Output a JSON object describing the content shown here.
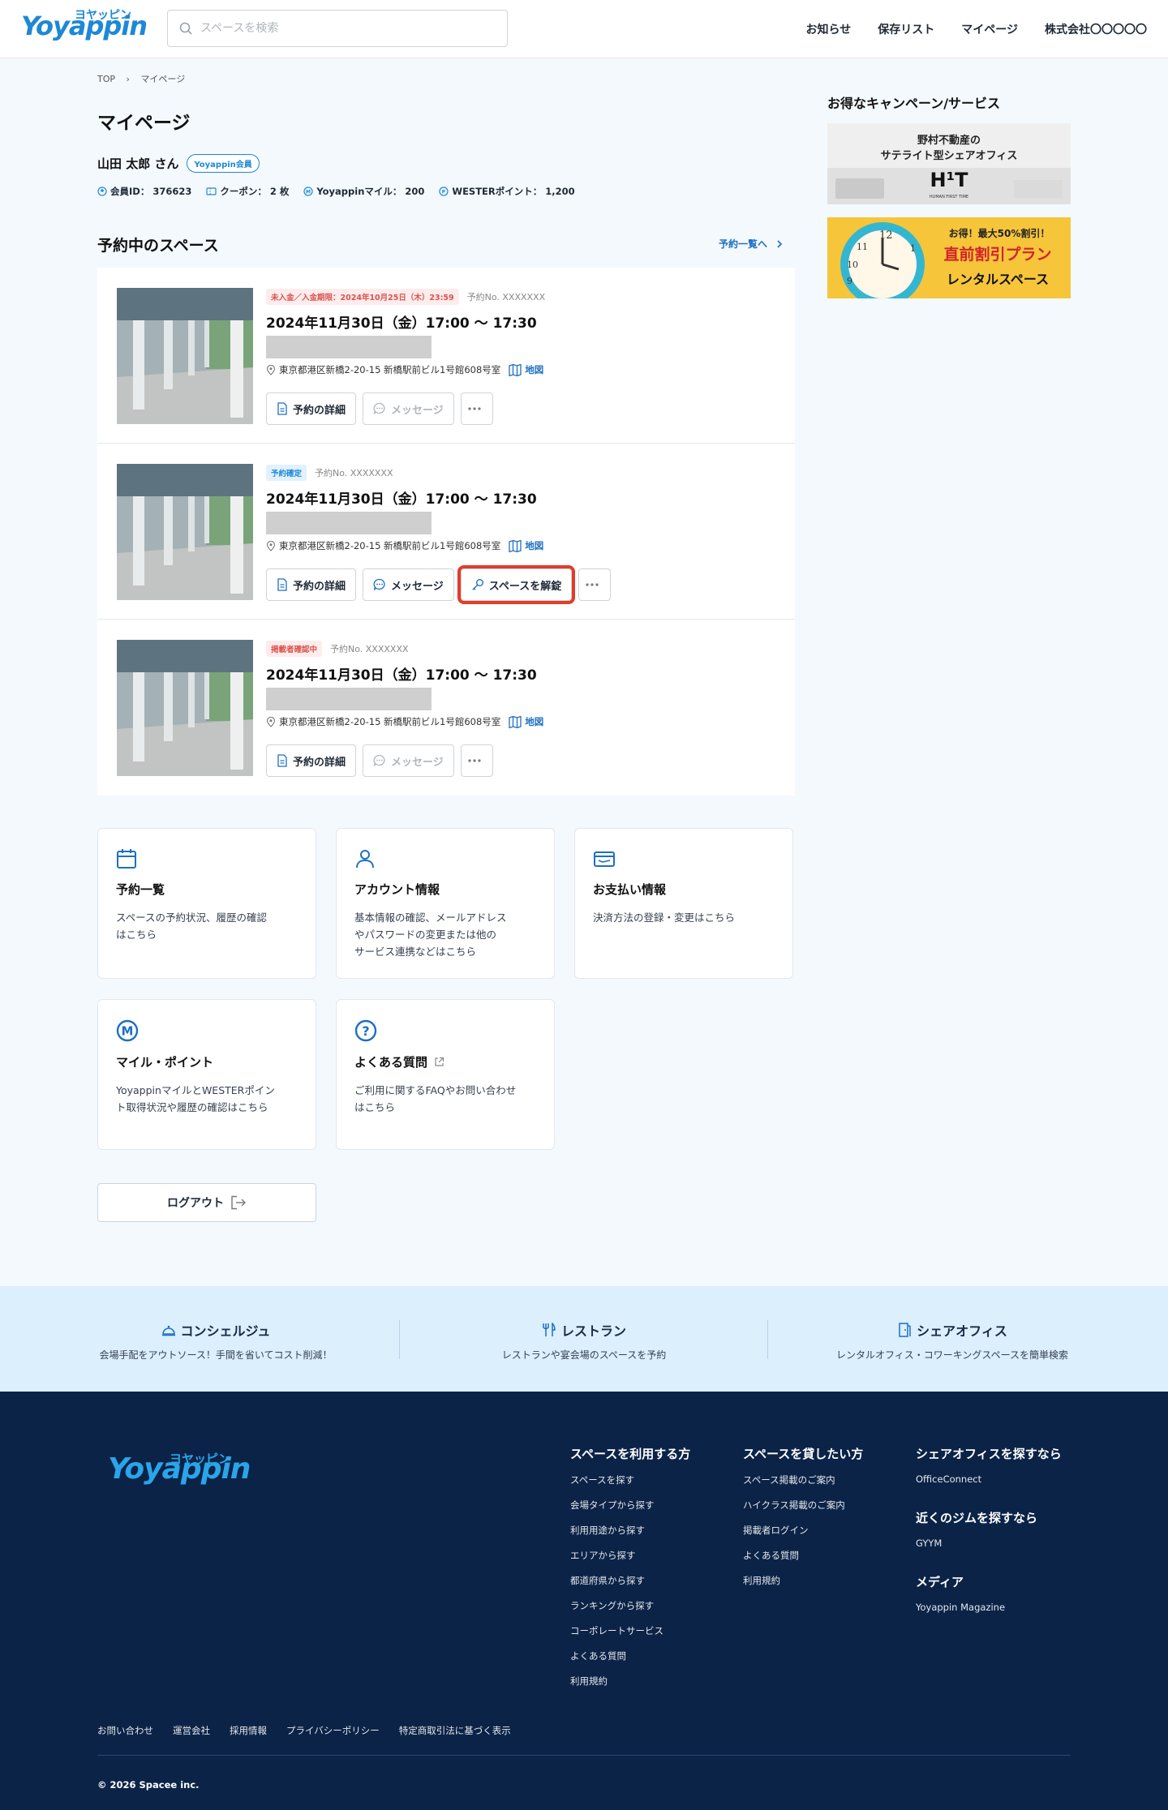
{
  "header": {
    "logo_text": "Yoyappin",
    "logo_kana": "ヨヤッピン",
    "search_placeholder": "スペースを検索",
    "nav": [
      "お知らせ",
      "保存リスト",
      "マイページ",
      "株式会社〇〇〇〇〇"
    ]
  },
  "breadcrumb": [
    "TOP",
    "マイページ"
  ],
  "page_title": "マイページ",
  "user": {
    "name": "山田 太郎 さん",
    "badge": "Yoyappin会員",
    "member_id": "会員ID： 376623",
    "coupon": "クーポン： 2 枚",
    "miles": "Yoyappinマイル： 200",
    "wester": "WESTERポイント： 1,200"
  },
  "reservations_section": {
    "title": "予約中のスペース",
    "view_all": "予約一覧へ",
    "items": [
      {
        "tag": "未入金／入金期限：2024年10月25日（木）23:59",
        "tag_color": "#d9534f",
        "number": "予約No. XXXXXXX",
        "datetime": "2024年11月30日（金）17:00 〜 17:30",
        "address": "東京都港区新橋2-20-15 新橋駅前ビル1号館608号室",
        "map_label": "地図",
        "detail_label": "予約の詳細",
        "message_label": "メッセージ"
      },
      {
        "tag": "予約確定",
        "tag_color": "#1e88d6",
        "number": "予約No. XXXXXXX",
        "datetime": "2024年11月30日（金）17:00 〜 17:30",
        "address": "東京都港区新橋2-20-15 新橋駅前ビル1号館608号室",
        "map_label": "地図",
        "detail_label": "予約の詳細",
        "message_label": "メッセージ",
        "unlock_label": "スペースを解錠"
      },
      {
        "tag": "掲載者確認中",
        "tag_color": "#d9534f",
        "number": "予約No. XXXXXXX",
        "datetime": "2024年11月30日（金）17:00 〜 17:30",
        "address": "東京都港区新橋2-20-15 新橋駅前ビル1号館608号室",
        "map_label": "地図",
        "detail_label": "予約の詳細",
        "message_label": "メッセージ"
      }
    ]
  },
  "cards": [
    {
      "title": "予約一覧",
      "desc": "スペースの予約状況、履歴の確認\nはこちら",
      "icon": "calendar-icon"
    },
    {
      "title": "アカウント情報",
      "desc": "基本情報の確認、メールアドレス\nやパスワードの変更または他の\nサービス連携などはこちら",
      "icon": "user-icon"
    },
    {
      "title": "お支払い情報",
      "desc": "決済方法の登録・変更はこちら",
      "icon": "wallet-icon"
    },
    {
      "title": "マイル・ポイント",
      "desc": "YoyappinマイルとWESTERポイン\nト取得状況や履歴の確認はこちら",
      "icon": "mile-icon"
    },
    {
      "title": "よくある質問",
      "desc": "ご利用に関するFAQやお問い合わせ\nはこちら",
      "icon": "question-icon"
    }
  ],
  "logout_label": "ログアウト",
  "sidebar": {
    "title": "お得なキャンペーン/サービス",
    "banner1": {
      "line1": "野村不動産の",
      "line2": "サテライト型シェアオフィス",
      "brand": "H¹T",
      "tagline": "HUMAN FIRST TIME"
    },
    "banner2": {
      "line1": "お得！最大50%割引！",
      "line2": "直前割引プラン",
      "line3": "レンタルスペース"
    }
  },
  "services": [
    {
      "title": "コンシェルジュ",
      "desc": "会場手配をアウトソース！手間を省いてコスト削減！"
    },
    {
      "title": "レストラン",
      "desc": "レストランや宴会場のスペースを予約"
    },
    {
      "title": "シェアオフィス",
      "desc": "レンタルオフィス・コワーキングスペースを簡単検索"
    }
  ],
  "footer": {
    "col1": {
      "title": "スペースを利用する方",
      "links": [
        "スペースを探す",
        "会場タイプから探す",
        "利用用途から探す",
        "エリアから探す",
        "都道府県から探す",
        "ランキングから探す",
        "コーポレートサービス",
        "よくある質問",
        "利用規約"
      ]
    },
    "col2": {
      "title": "スペースを貸したい方",
      "links": [
        "スペース掲載のご案内",
        "ハイクラス掲載のご案内",
        "掲載者ログイン",
        "よくある質問",
        "利用規約"
      ]
    },
    "col3": [
      {
        "title": "シェアオフィスを探すなら",
        "link": "OfficeConnect"
      },
      {
        "title": "近くのジムを探すなら",
        "link": "GYYM"
      },
      {
        "title": "メディア",
        "link": "Yoyappin Magazine"
      }
    ],
    "bottom_links": [
      "お問い合わせ",
      "運営会社",
      "採用情報",
      "プライバシーポリシー",
      "特定商取引法に基づく表示"
    ],
    "copyright": "© 2026 Spacee inc."
  },
  "colors": {
    "accent": "#1e88d6",
    "footer_bg": "#0b2347",
    "highlight": "#e23c2a"
  }
}
